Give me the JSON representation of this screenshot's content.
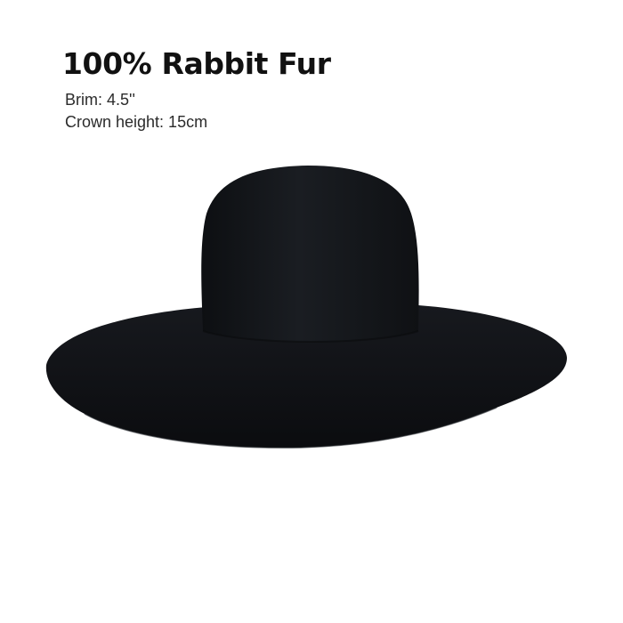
{
  "product": {
    "title": "100% Rabbit Fur",
    "specs": {
      "brim": "Brim: 4.5''",
      "crown_height": "Crown height: 15cm"
    },
    "image_icon": "wide-brim-hat",
    "hat_color": "#121418",
    "background_color": "#ffffff"
  }
}
